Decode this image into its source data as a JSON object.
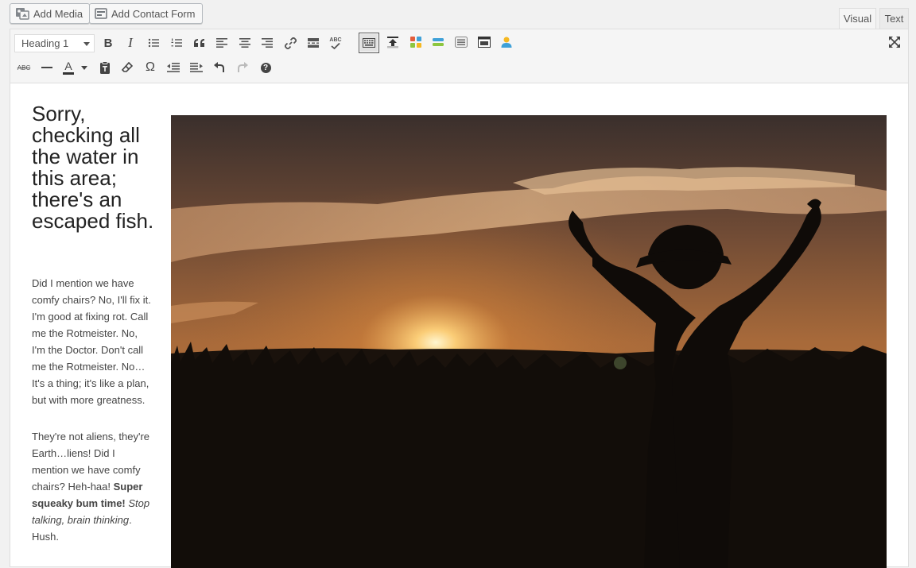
{
  "toolbar_top": {
    "add_media_label": "Add Media",
    "add_contact_form_label": "Add Contact Form",
    "tabs": [
      {
        "label": "Visual"
      },
      {
        "label": "Text"
      }
    ]
  },
  "editor_toolbar": {
    "format_select_value": "Heading 1",
    "row1_icons": [
      "bold-icon",
      "italic-icon",
      "bulleted-list-icon",
      "numbered-list-icon",
      "blockquote-icon",
      "align-left-icon",
      "align-center-icon",
      "align-right-icon",
      "link-icon",
      "read-more-icon",
      "spellcheck-icon",
      "toolbar-toggle-icon",
      "upload-icon",
      "color-grid-icon",
      "stack-icon",
      "list-box-icon",
      "window-icon",
      "user-icon",
      "fullscreen-icon"
    ],
    "row2_icons": [
      "strikethrough-icon",
      "horizontal-line-icon",
      "text-color-icon",
      "paste-as-text-icon",
      "clear-formatting-icon",
      "special-character-icon",
      "outdent-icon",
      "indent-icon",
      "undo-icon",
      "redo-icon",
      "help-icon"
    ],
    "labels": {
      "bold": "B",
      "italic": "I",
      "omega": "Ω",
      "abc": "ABC",
      "text_color": "A",
      "help": "?"
    }
  },
  "content": {
    "heading": "Sorry, checking all the water in this area; there's an escaped fish.",
    "paragraph1": "Did I mention we have comfy chairs? No, I'll fix it. I'm good at fixing rot. Call me the Rotmeister. No, I'm the Doctor. Don't call me the Rotmeister. No… It's a thing; it's like a plan, but with more greatness.",
    "paragraph2": {
      "part1": "They're not aliens, they're Earth…liens! Did I mention we have comfy chairs? Heh-haa! ",
      "bold": "Super squeaky bum time!",
      "space": " ",
      "italic": "Stop talking, brain thinking",
      "part2": ". Hush."
    },
    "image_subject": "silhouette of person with hat raising arms at sunset in a grass field"
  },
  "colors": {
    "editor_bg": "#ffffff",
    "toolbar_bg": "#f5f5f5",
    "page_bg": "#f1f1f1",
    "sky_top": "#3a2f2c",
    "sun": "#fff3c4",
    "field": "#120d09"
  }
}
